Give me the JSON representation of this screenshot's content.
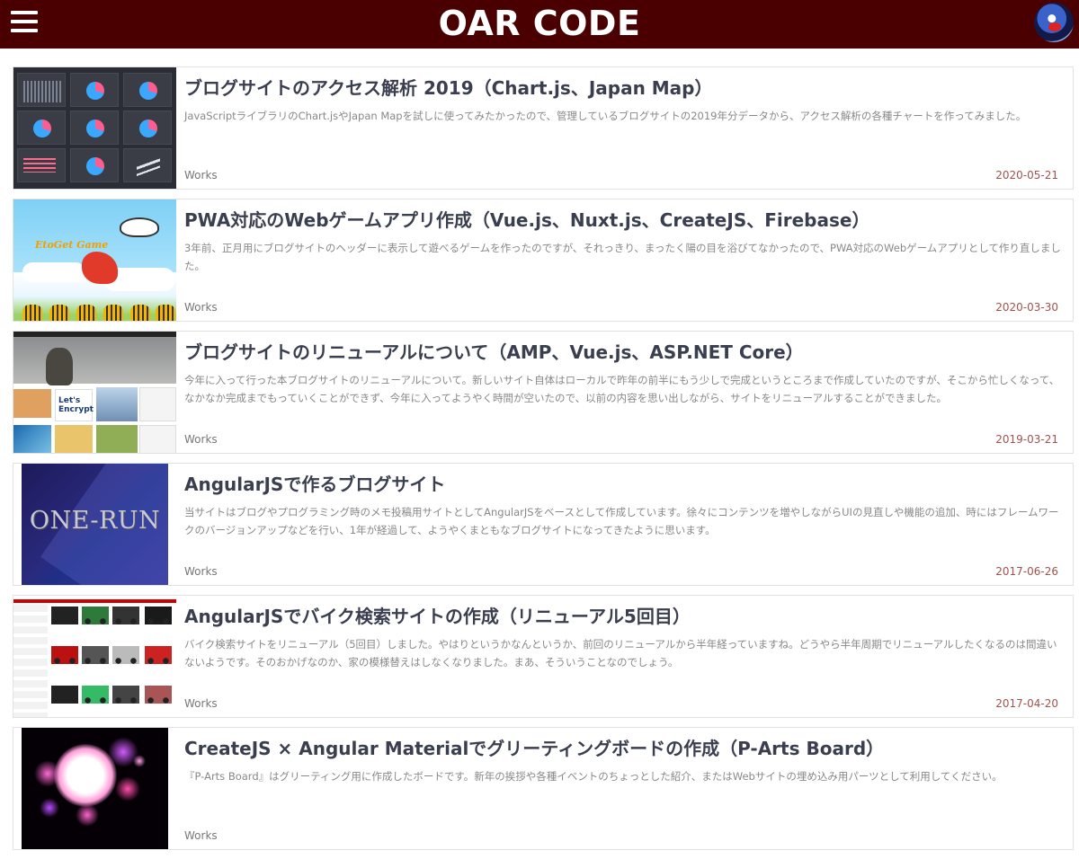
{
  "header": {
    "site_title": "OAR CODE",
    "menu_icon": "hamburger-menu-icon",
    "avatar": "user-avatar",
    "background_color": "#4a0000"
  },
  "posts": [
    {
      "title": "ブログサイトのアクセス解析 2019（Chart.js、Japan Map）",
      "description": "JavaScriptライブラリのChart.jsやJapan Mapを試しに使ってみたかったので、管理しているブログサイトの2019年分データから、アクセス解析の各種チャートを作ってみました。",
      "category": "Works",
      "date": "2020-05-21"
    },
    {
      "title": "PWA対応のWebゲームアプリ作成（Vue.js、Nuxt.js、CreateJS、Firebase）",
      "description": "3年前、正月用にブログサイトのヘッダーに表示して遊べるゲームを作ったのですが、それっきり、まったく陽の目を浴びてなかったので、PWA対応のWebゲームアプリとして作り直しました。",
      "category": "Works",
      "date": "2020-03-30",
      "thumbnail_text": "EtoGet Game"
    },
    {
      "title": "ブログサイトのリニューアルについて（AMP、Vue.js、ASP.NET Core）",
      "description": "今年に入って行った本ブログサイトのリニューアルについて。新しいサイト自体はローカルで昨年の前半にもう少しで完成というところまで作成していたのですが、そこから忙しくなって、なかなか完成までもっていくことができず、今年に入ってようやく時間が空いたので、以前の内容を思い出しながら、サイトをリニューアルすることができました。",
      "category": "Works",
      "date": "2019-03-21",
      "thumbnail_text": "Let's Encrypt"
    },
    {
      "title": "AngularJSで作るブログサイト",
      "description": "当サイトはブログやプログラミング時のメモ投稿用サイトとしてAngularJSをベースとして作成しています。徐々にコンテンツを増やしながらUIの見直しや機能の追加、時にはフレームワークのバージョンアップなどを行い、1年が経過して、ようやくまともなブログサイトになってきたように思います。",
      "category": "Works",
      "date": "2017-06-26",
      "thumbnail_text": "ONE-RUN"
    },
    {
      "title": "AngularJSでバイク検索サイトの作成（リニューアル5回目）",
      "description": "バイク検索サイトをリニューアル（5回目）しました。やはりというかなんというか、前回のリニューアルから半年経っていますね。どうやら半年周期でリニューアルしたくなるのは間違いないようです。そのおかげなのか、家の模様替えはしなくなりました。まあ、そういうことなのでしょう。",
      "category": "Works",
      "date": "2017-04-20"
    },
    {
      "title": "CreateJS × Angular Materialでグリーティングボードの作成（P-Arts Board）",
      "description": "『P-Arts Board』はグリーティング用に作成したボードです。新年の挨拶や各種イベントのちょっとした紹介、またはWebサイトの埋め込み用パーツとして利用してください。",
      "category": "Works",
      "date": ""
    }
  ]
}
